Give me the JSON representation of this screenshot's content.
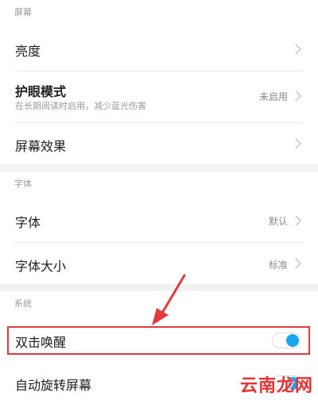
{
  "sections": {
    "screen": {
      "header": "屏幕"
    },
    "font": {
      "header": "字体"
    },
    "system": {
      "header": "系统"
    }
  },
  "rows": {
    "brightness": {
      "title": "亮度"
    },
    "eye_care": {
      "title": "护眼模式",
      "subtitle": "在长期阅读时启用，减少蓝光伤害",
      "value": "未启用"
    },
    "screen_effect": {
      "title": "屏幕效果"
    },
    "font": {
      "title": "字体",
      "value": "默认"
    },
    "font_size": {
      "title": "字体大小",
      "value": "标准"
    },
    "double_tap_wake": {
      "title": "双击唤醒",
      "enabled": true
    },
    "auto_rotate": {
      "title": "自动旋转屏幕",
      "enabled": true
    }
  },
  "watermark": {
    "text": "云南龙网"
  },
  "colors": {
    "toggle_on": "#1aa3f0",
    "highlight": "#e23b3b",
    "section_bg": "#f5f5f5"
  }
}
